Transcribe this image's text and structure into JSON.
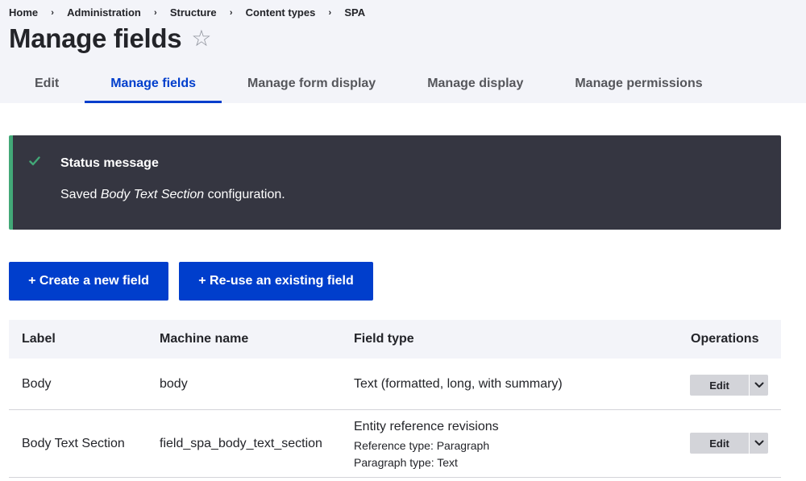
{
  "breadcrumb": [
    "Home",
    "Administration",
    "Structure",
    "Content types",
    "SPA"
  ],
  "page": {
    "title": "Manage fields"
  },
  "tabs": [
    {
      "label": "Edit",
      "active": false
    },
    {
      "label": "Manage fields",
      "active": true
    },
    {
      "label": "Manage form display",
      "active": false
    },
    {
      "label": "Manage display",
      "active": false
    },
    {
      "label": "Manage permissions",
      "active": false
    }
  ],
  "status": {
    "title": "Status message",
    "text_prefix": "Saved ",
    "text_emphasis": "Body Text Section",
    "text_suffix": " configuration."
  },
  "actions": {
    "create_label": "+ Create a new field",
    "reuse_label": "+ Re-use an existing field"
  },
  "table": {
    "headers": [
      "Label",
      "Machine name",
      "Field type",
      "Operations"
    ],
    "rows": [
      {
        "label": "Body",
        "machine_name": "body",
        "field_type": "Text (formatted, long, with summary)",
        "details": [],
        "operation": "Edit"
      },
      {
        "label": "Body Text Section",
        "machine_name": "field_spa_body_text_section",
        "field_type": "Entity reference revisions",
        "details": [
          "Reference type: Paragraph",
          "Paragraph type: Text"
        ],
        "operation": "Edit"
      }
    ]
  },
  "icons": {
    "favorite": "star-outline-icon",
    "status": "check-icon",
    "dropdown": "chevron-down-icon"
  },
  "colors": {
    "accent": "#003ecc",
    "status_bg": "#353641",
    "status_border": "#42a877",
    "header_bg": "#f3f4f9"
  }
}
